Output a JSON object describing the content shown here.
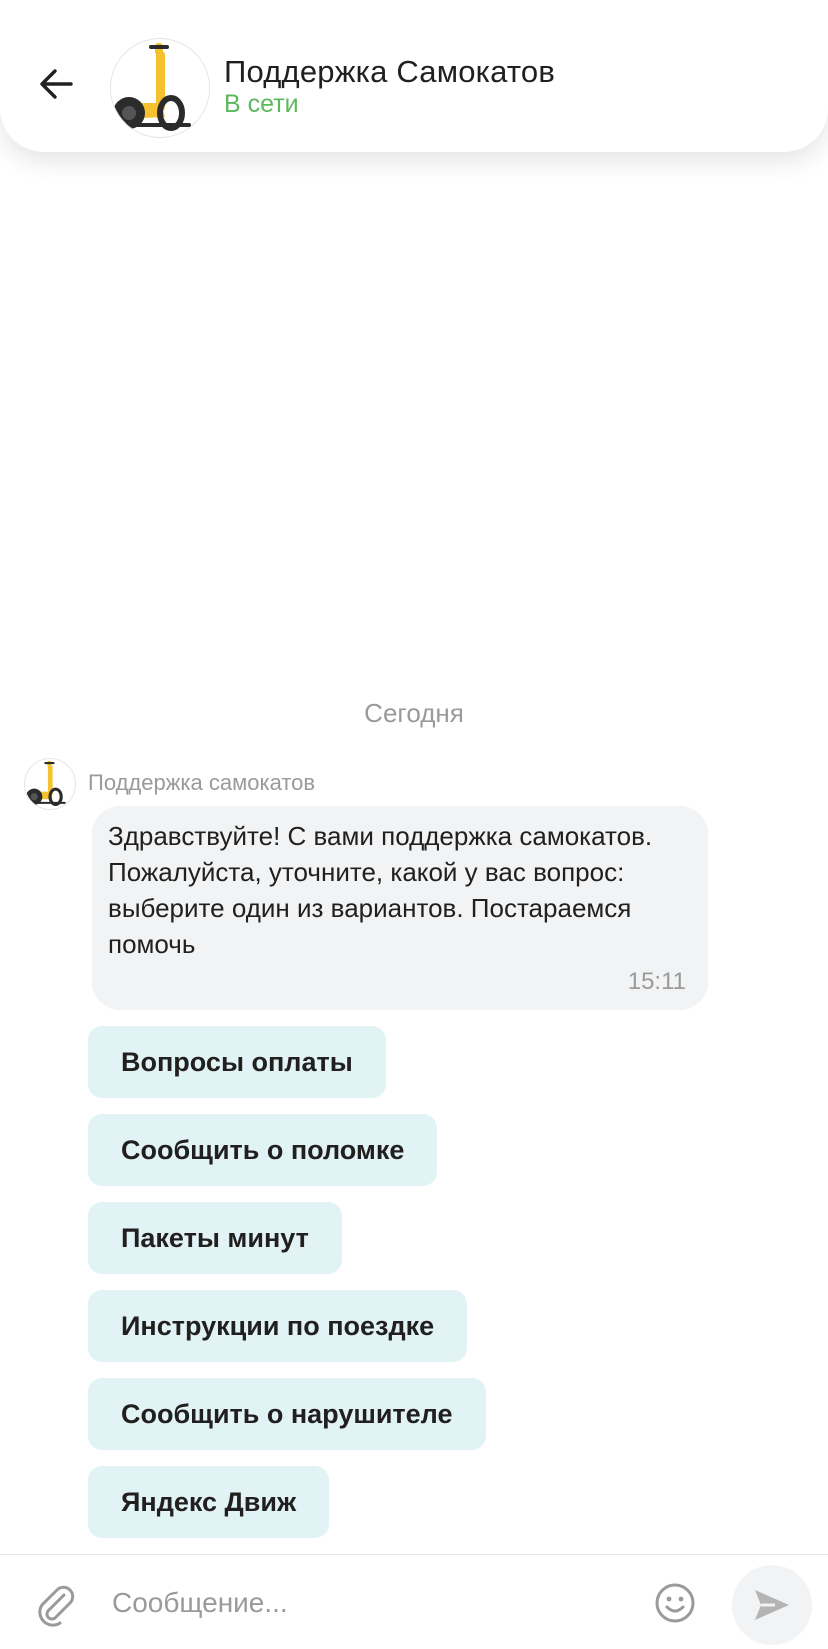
{
  "header": {
    "title": "Поддержка Самокатов",
    "status": "В сети",
    "status_color": "#5cb85c",
    "back_icon": "arrow-left-icon",
    "avatar_icon": "scooter-icon"
  },
  "chat": {
    "date_separator": "Сегодня",
    "messages": [
      {
        "sender": "Поддержка самокатов",
        "text": "Здравствуйте! С вами поддержка самокатов.\nПожалуйста, уточните, какой у вас вопрос: выберите один из вариантов. Постараемся помочь",
        "time": "15:11"
      }
    ],
    "quick_replies": [
      "Вопросы оплаты",
      "Сообщить о поломке",
      "Пакеты минут",
      "Инструкции по поездке",
      "Сообщить о нарушителе",
      "Яндекс Движ"
    ]
  },
  "composer": {
    "placeholder": "Сообщение...",
    "attach_icon": "paperclip-icon",
    "emoji_icon": "smile-icon",
    "send_icon": "send-icon"
  },
  "colors": {
    "quick_reply_bg": "#e2f3f6",
    "bubble_bg": "#f2f3f4",
    "scooter_yellow": "#f5c12e"
  }
}
